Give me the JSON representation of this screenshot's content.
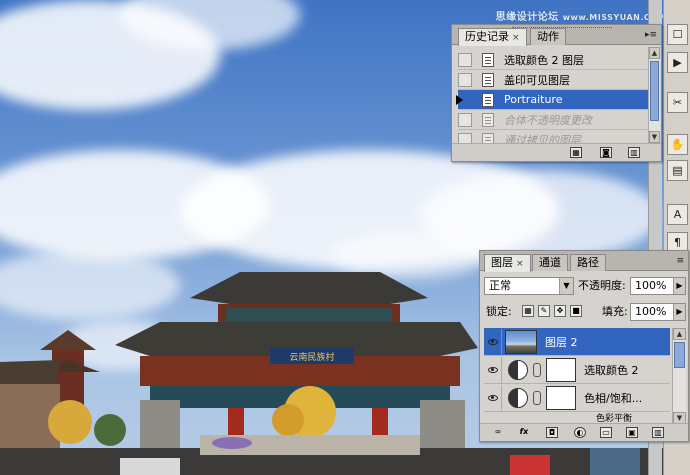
{
  "watermark": {
    "text": "思缘设计论坛",
    "site": "www.MISSYUAN.COM"
  },
  "history_panel": {
    "tabs": [
      {
        "label": "历史记录",
        "active": true,
        "close": "×"
      },
      {
        "label": "动作",
        "active": false
      }
    ],
    "items": [
      {
        "label": "选取颜色 2 图层",
        "state": "normal"
      },
      {
        "label": "盖印可见图层",
        "state": "normal"
      },
      {
        "label": "Portraiture",
        "state": "selected"
      },
      {
        "label": "合体不透明度更改",
        "state": "dimmed"
      },
      {
        "label": "通过拷贝的图层",
        "state": "dimmed"
      }
    ],
    "footer_icons": [
      "new-snapshot-icon",
      "camera-icon",
      "trash-icon"
    ]
  },
  "layers_panel": {
    "tabs": [
      {
        "label": "图层",
        "active": true,
        "close": "×"
      },
      {
        "label": "通道",
        "active": false
      },
      {
        "label": "路径",
        "active": false
      }
    ],
    "blend_mode": "正常",
    "opacity_label": "不透明度:",
    "opacity_value": "100%",
    "lock_label": "锁定:",
    "fill_label": "填充:",
    "fill_value": "100%",
    "layers": [
      {
        "name": "图层 2",
        "kind": "image",
        "selected": true
      },
      {
        "name": "选取颜色 2",
        "kind": "adjustment",
        "selected": false
      },
      {
        "name": "色相/饱和...",
        "kind": "adjustment",
        "selected": false
      },
      {
        "name": "色彩平衡",
        "kind": "adjustment",
        "selected": false
      }
    ],
    "footer_icons": [
      "link-icon",
      "fx-icon",
      "mask-icon",
      "adjustment-icon",
      "group-icon",
      "new-layer-icon",
      "trash-icon"
    ]
  },
  "toolbar": {
    "icons": [
      "tool-icon-1",
      "tool-icon-2",
      "tool-icon-3",
      "tool-icon-4",
      "tool-icon-5",
      "text-tool-icon"
    ]
  },
  "colors": {
    "selection": "#3265c0",
    "panel_bg": "#d6d3ce"
  }
}
